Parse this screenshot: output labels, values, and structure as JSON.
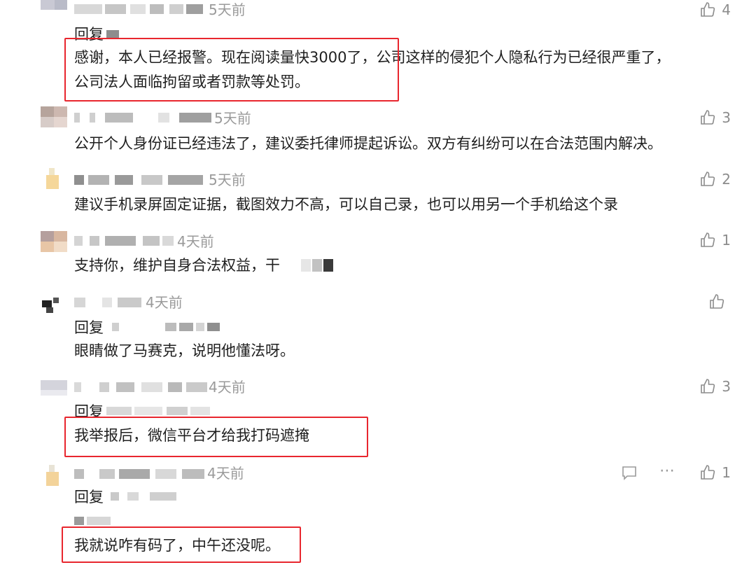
{
  "comments": [
    {
      "time": "5天前",
      "likes": "4",
      "reply_prefix": "回复",
      "text_lines": [
        "感谢，本人已经报警。现在阅读量快3000了，公司这样的侵犯个人隐私行为已经很严重了，",
        "公司法人面临拘留或者罚款等处罚。"
      ]
    },
    {
      "time": "5天前",
      "likes": "3",
      "text": "公开个人身份证已经违法了，建议委托律师提起诉讼。双方有纠纷可以在合法范围内解决。"
    },
    {
      "time": "5天前",
      "likes": "2",
      "text": "建议手机录屏固定证据，截图效力不高，可以自己录，也可以用另一个手机给这个录"
    },
    {
      "time": "4天前",
      "likes": "1",
      "text": "支持你，维护自身合法权益，干"
    },
    {
      "time": "4天前",
      "likes": "",
      "reply_prefix": "回复",
      "text": "眼睛做了马赛克，说明他懂法呀。"
    },
    {
      "time": "4天前",
      "likes": "3",
      "reply_prefix": "回复",
      "text": "我举报后，微信平台才给我打码遮掩"
    },
    {
      "time": "4天前",
      "likes": "1",
      "reply_prefix": "回复",
      "text": "我就说咋有码了，中午还没呢。"
    }
  ],
  "icons": {
    "like": "thumbs-up-icon",
    "reply": "comment-icon",
    "more": "more-icon"
  },
  "colors": {
    "highlight": "#e8262e",
    "muted": "#9a9a9a"
  }
}
